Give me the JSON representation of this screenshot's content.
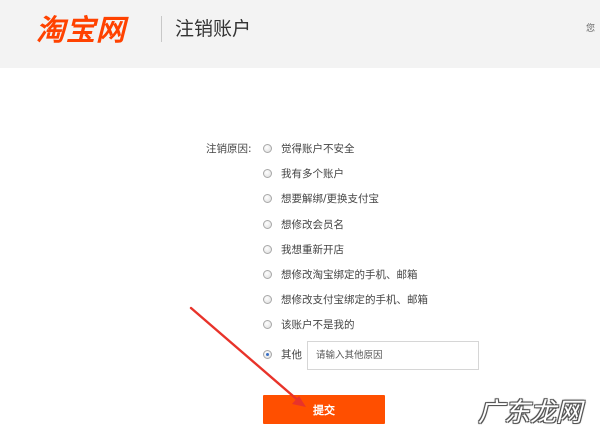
{
  "header": {
    "logo": "淘宝网",
    "title": "注销账户",
    "user_text": "您"
  },
  "form": {
    "label": "注销原因:",
    "options": [
      "觉得账户不安全",
      "我有多个账户",
      "想要解绑/更换支付宝",
      "想修改会员名",
      "我想重新开店",
      "想修改淘宝绑定的手机、邮箱",
      "想修改支付宝绑定的手机、邮箱",
      "该账户不是我的"
    ],
    "other_label": "其他",
    "other_selected": true,
    "other_placeholder": "请输入其他原因",
    "other_value": ""
  },
  "submit_label": "提交",
  "annotation_arrow": {
    "color": "#e8332a"
  },
  "watermark": "广东龙网",
  "colors": {
    "brand": "#ff4200",
    "button": "#ff4f00",
    "header_bg": "#f3f3f3"
  }
}
